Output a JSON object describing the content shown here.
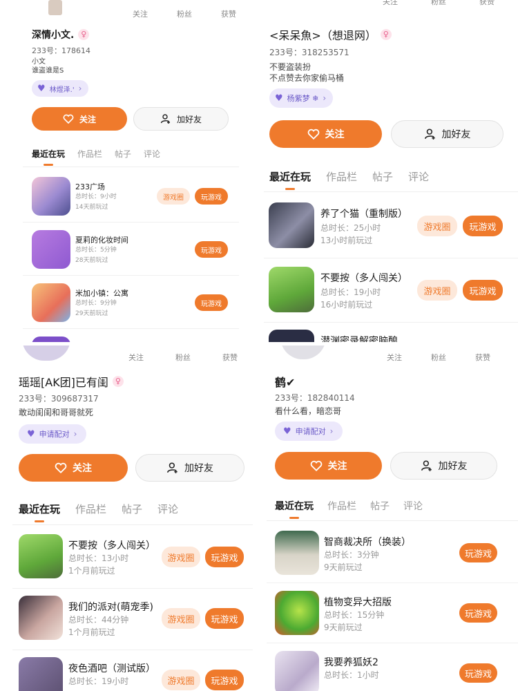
{
  "panels": [
    {
      "stats": [
        "关注",
        "粉丝",
        "获赞"
      ],
      "name": "深情小文.",
      "gender_icon": "♀",
      "id": "233号：178614",
      "bio": [
        "小文",
        "谁盗谁是S"
      ],
      "pill": "林煜泽.'",
      "follow": "关注",
      "add_friend": "加好友",
      "tabs": [
        "最近在玩",
        "作品栏",
        "帖子",
        "评论"
      ],
      "games": [
        {
          "name": "233广场",
          "duration": "总时长：9小时",
          "last": "14天前玩过",
          "circle": "游戏圈",
          "play": "玩游戏"
        },
        {
          "name": "夏莉的化妆时间",
          "duration": "总时长：5分钟",
          "last": "28天前玩过",
          "play": "玩游戏"
        },
        {
          "name": "米加小镇：公寓",
          "duration": "总时长：9分钟",
          "last": "29天前玩过",
          "play": "玩游戏"
        }
      ]
    },
    {
      "stats": [
        "关注",
        "粉丝",
        "获赞"
      ],
      "name": "<呆呆魚>（想退网）",
      "gender_icon": "♀",
      "id": "233号：318253571",
      "bio": [
        "不要盗装扮",
        "不点赞去你家偷马桶"
      ],
      "pill": "杨紫梦 ❄",
      "follow": "关注",
      "add_friend": "加好友",
      "tabs": [
        "最近在玩",
        "作品栏",
        "帖子",
        "评论"
      ],
      "games": [
        {
          "name": "养了个猫（重制版）",
          "duration": "总时长：25小时",
          "last": "13小时前玩过",
          "circle": "游戏圈",
          "play": "玩游戏"
        },
        {
          "name": "不要按（多人闯关）",
          "duration": "总时长：19小时",
          "last": "16小时前玩过",
          "circle": "游戏圈",
          "play": "玩游戏"
        },
        {
          "name": "潜渊密录解密脑酿"
        }
      ]
    },
    {
      "stats": [
        "关注",
        "粉丝",
        "获赞"
      ],
      "name": "瑶瑶[AK团]已有闺",
      "gender_icon": "♀",
      "id": "233号：309687317",
      "bio": [
        "敢动闺闺和哥哥就死"
      ],
      "pill": "申请配对",
      "follow": "关注",
      "add_friend": "加好友",
      "tabs": [
        "最近在玩",
        "作品栏",
        "帖子",
        "评论"
      ],
      "games": [
        {
          "name": "不要按（多人闯关）",
          "duration": "总时长：13小时",
          "last": "1个月前玩过",
          "circle": "游戏圈",
          "play": "玩游戏"
        },
        {
          "name": "我们的派对(萌宠季)",
          "duration": "总时长：44分钟",
          "last": "1个月前玩过",
          "circle": "游戏圈",
          "play": "玩游戏"
        },
        {
          "name": "夜色酒吧（测试版）",
          "duration": "总时长：19小时",
          "circle": "游戏圈",
          "play": "玩游戏"
        }
      ]
    },
    {
      "stats": [
        "关注",
        "粉丝",
        "获赞"
      ],
      "name": "鹤✔",
      "id": "233号：182840114",
      "bio": [
        "看什么看，暗恋哥"
      ],
      "pill": "申请配对",
      "follow": "关注",
      "add_friend": "加好友",
      "tabs": [
        "最近在玩",
        "作品栏",
        "帖子",
        "评论"
      ],
      "games": [
        {
          "name": "智商裁决所（换装）",
          "duration": "总时长：3分钟",
          "last": "9天前玩过",
          "play": "玩游戏"
        },
        {
          "name": "植物变异大招版",
          "duration": "总时长：15分钟",
          "last": "9天前玩过",
          "play": "玩游戏"
        },
        {
          "name": "我要养狐妖2",
          "duration": "总时长：1小时",
          "play": "玩游戏"
        }
      ]
    }
  ],
  "colors": {
    "accent": "#ef7a2c",
    "pill_bg": "#ece8fb",
    "pill_text": "#6b5ac8"
  }
}
